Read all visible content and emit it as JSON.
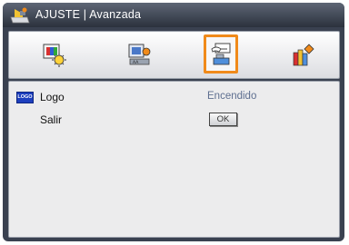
{
  "title": {
    "text": "AJUSTE | Avanzada",
    "icon": "settings-menu-icon"
  },
  "tabs": [
    {
      "name": "image",
      "icon": "image-settings-icon",
      "selected": false
    },
    {
      "name": "display",
      "icon": "display-settings-icon",
      "selected": false
    },
    {
      "name": "setup",
      "icon": "setup-settings-icon",
      "selected": true
    },
    {
      "name": "options",
      "icon": "options-settings-icon",
      "selected": false
    }
  ],
  "menu": {
    "logo": {
      "badge": "LOGO",
      "label": "Logo",
      "value": "Encendido"
    },
    "exit": {
      "label": "Salir",
      "button": "OK"
    }
  },
  "colors": {
    "accent": "#f08a1a",
    "value_text": "#5e6f90",
    "chrome": "#3a4150"
  }
}
